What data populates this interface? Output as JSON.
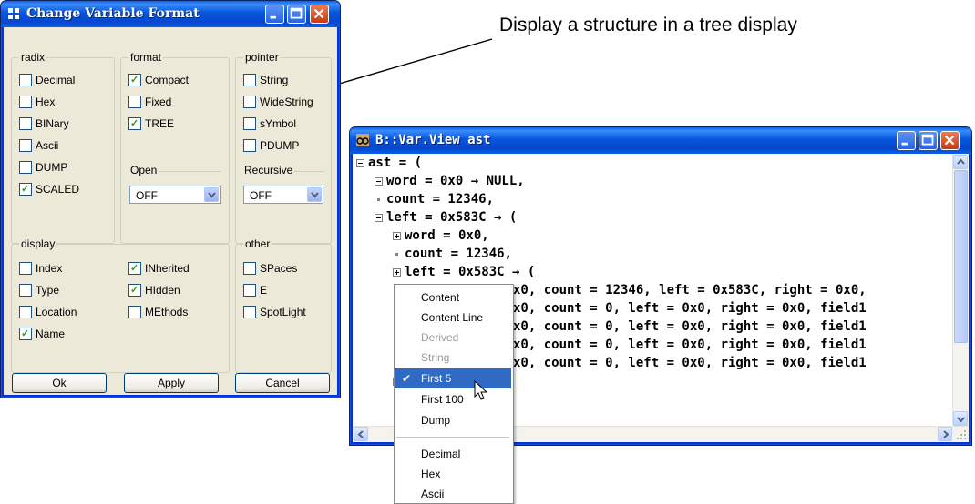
{
  "annotation": {
    "text": "Display a structure in a tree display"
  },
  "format_dialog": {
    "title": "Change Variable Format",
    "groups": {
      "radix": {
        "label": "radix",
        "items": [
          {
            "label": "Decimal",
            "checked": false
          },
          {
            "label": "Hex",
            "checked": false
          },
          {
            "label": "BINary",
            "checked": false
          },
          {
            "label": "Ascii",
            "checked": false
          },
          {
            "label": "DUMP",
            "checked": false
          },
          {
            "label": "SCALED",
            "checked": true
          }
        ]
      },
      "format": {
        "label": "format",
        "items": [
          {
            "label": "Compact",
            "checked": true
          },
          {
            "label": "Fixed",
            "checked": false
          },
          {
            "label": "TREE",
            "checked": true
          }
        ],
        "open_label": "Open",
        "open_value": "OFF"
      },
      "pointer": {
        "label": "pointer",
        "items": [
          {
            "label": "String",
            "checked": false
          },
          {
            "label": "WideString",
            "checked": false
          },
          {
            "label": "sYmbol",
            "checked": false
          },
          {
            "label": "PDUMP",
            "checked": false
          }
        ],
        "recursive_label": "Recursive",
        "recursive_value": "OFF"
      },
      "display": {
        "label": "display",
        "col1": [
          {
            "label": "Index",
            "checked": false
          },
          {
            "label": "Type",
            "checked": false
          },
          {
            "label": "Location",
            "checked": false
          },
          {
            "label": "Name",
            "checked": true
          }
        ],
        "col2": [
          {
            "label": "INherited",
            "checked": true
          },
          {
            "label": "HIdden",
            "checked": true
          },
          {
            "label": "MEthods",
            "checked": false
          }
        ]
      },
      "other": {
        "label": "other",
        "items": [
          {
            "label": "SPaces",
            "checked": false
          },
          {
            "label": "E",
            "checked": false
          },
          {
            "label": "SpotLight",
            "checked": false
          }
        ]
      }
    },
    "buttons": {
      "ok": "Ok",
      "apply": "Apply",
      "cancel": "Cancel"
    }
  },
  "var_view": {
    "title": "B::Var.View ast",
    "lines": [
      "ast = (",
      "word = 0x0 → NULL,",
      "count = 12346,",
      "left = 0x583C → (",
      "word = 0x0,",
      "count = 12346,",
      "left = 0x583C → (",
      "x0, count = 12346, left = 0x583C, right = 0x0,",
      "x0, count = 0, left = 0x0, right = 0x0, field1",
      "x0, count = 0, left = 0x0, right = 0x0, field1",
      "x0, count = 0, left = 0x0, right = 0x0, field1",
      "x0, count = 0, left = 0x0, right = 0x0, field1"
    ]
  },
  "context_menu": {
    "items": [
      {
        "label": "Content",
        "state": "normal"
      },
      {
        "label": "Content Line",
        "state": "normal"
      },
      {
        "label": "Derived",
        "state": "disabled"
      },
      {
        "label": "String",
        "state": "disabled"
      },
      {
        "label": "First 5",
        "state": "selected",
        "check": "✔"
      },
      {
        "label": "First 100",
        "state": "normal"
      },
      {
        "label": "Dump",
        "state": "normal"
      },
      {
        "label": "Decimal",
        "state": "normal"
      },
      {
        "label": "Hex",
        "state": "normal"
      },
      {
        "label": "Ascii",
        "state": "normal"
      }
    ]
  },
  "colors": {
    "xp_title": "#0855dd",
    "dialog_bg": "#ece9d8",
    "menu_highlight": "#316ac5",
    "check_green": "#21a121"
  }
}
